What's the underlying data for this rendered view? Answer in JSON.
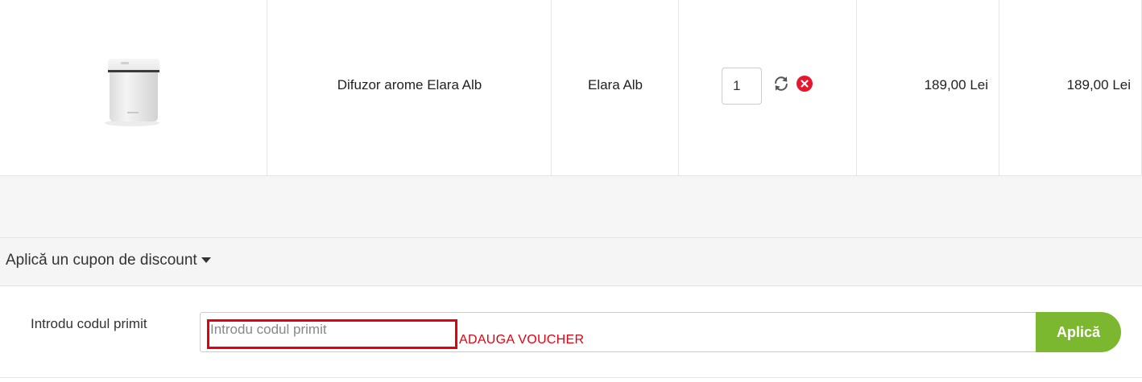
{
  "cart": {
    "product": {
      "name": "Difuzor arome Elara Alb",
      "model": "Elara Alb",
      "quantity": "1",
      "unit_price": "189,00 Lei",
      "total": "189,00 Lei",
      "image_icon": "aroma-diffuser-image"
    },
    "actions": {
      "update_icon": "refresh-icon",
      "remove_icon": "remove-icon",
      "remove_color": "#e8162c"
    }
  },
  "coupon": {
    "heading": "Aplică un cupon de discount",
    "label": "Introdu codul primit",
    "placeholder": "Introdu codul primit",
    "value": "",
    "apply_label": "Aplică",
    "apply_color": "#7cb82f"
  },
  "annotation": {
    "text": "ADAUGA VOUCHER",
    "color": "#e4000f"
  }
}
